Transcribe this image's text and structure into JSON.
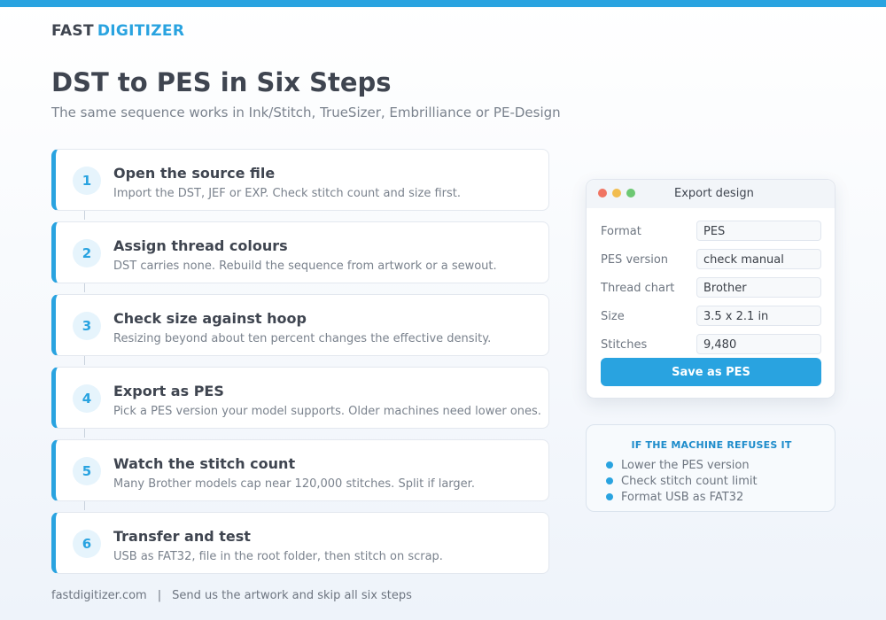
{
  "brand": {
    "word1": "FAST",
    "word2": "DIGITIZER"
  },
  "page": {
    "title": "DST to PES in Six Steps",
    "subtitle": "The same sequence works in Ink/Stitch, TrueSizer, Embrilliance or PE-Design"
  },
  "steps": [
    {
      "number": "1",
      "title": "Open the source file",
      "desc": "Import the DST, JEF or EXP. Check stitch count and size first."
    },
    {
      "number": "2",
      "title": "Assign thread colours",
      "desc": "DST carries none. Rebuild the sequence from artwork or a sewout."
    },
    {
      "number": "3",
      "title": "Check size against hoop",
      "desc": "Resizing beyond about ten percent changes the effective density."
    },
    {
      "number": "4",
      "title": "Export as PES",
      "desc": "Pick a PES version your model supports. Older machines need lower ones."
    },
    {
      "number": "5",
      "title": "Watch the stitch count",
      "desc": "Many Brother models cap near 120,000 stitches. Split if larger."
    },
    {
      "number": "6",
      "title": "Transfer and test",
      "desc": "USB as FAT32, file in the root folder, then stitch on scrap."
    }
  ],
  "export_window": {
    "title": "Export design",
    "fields": [
      {
        "label": "Format",
        "value": "PES"
      },
      {
        "label": "PES version",
        "value": "check manual"
      },
      {
        "label": "Thread chart",
        "value": "Brother"
      },
      {
        "label": "Size",
        "value": "3.5 x 2.1 in"
      },
      {
        "label": "Stitches",
        "value": "9,480"
      }
    ],
    "save_label": "Save as PES"
  },
  "refuse_box": {
    "title": "IF THE MACHINE REFUSES IT",
    "items": [
      "Lower the PES version",
      "Check stitch count limit",
      "Format USB as FAT32"
    ]
  },
  "footer": {
    "site": "fastdigitizer.com",
    "separator": "|",
    "cta": "Send us the artwork and skip all six steps"
  },
  "colors": {
    "accent": "#29a3e0",
    "text_dark": "#3f4550",
    "text_muted": "#7a828d"
  },
  "icons": [
    "window-close-dot",
    "window-minimize-dot",
    "window-maximize-dot",
    "bullet-dot"
  ]
}
